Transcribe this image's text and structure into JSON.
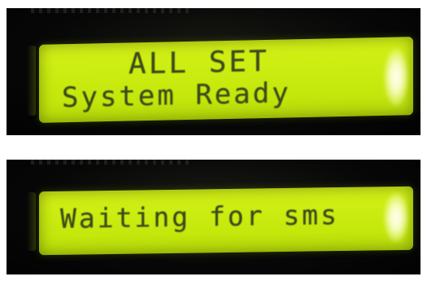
{
  "displays": [
    {
      "lines": [
        "ALL SET",
        "System Ready"
      ]
    },
    {
      "lines": [
        "Waiting for sms"
      ]
    }
  ],
  "colors": {
    "lcd_backlight": "#cdee12",
    "lcd_text": "#3b4a1a",
    "bezel": "#050505",
    "background": "#ffffff"
  }
}
